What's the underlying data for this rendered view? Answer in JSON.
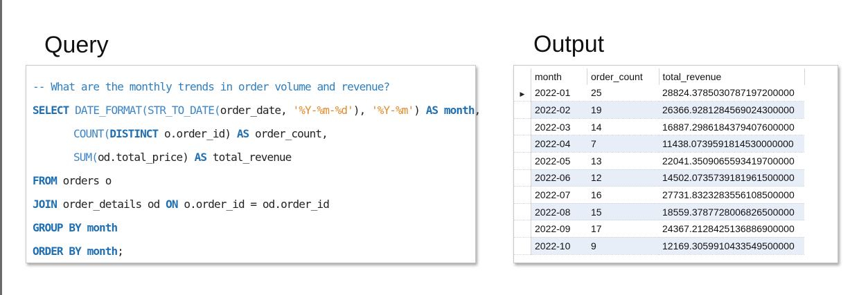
{
  "query_heading": "Query",
  "output_heading": "Output",
  "code": {
    "comment": "-- What are the monthly trends in order volume and revenue?",
    "select_kw": "SELECT",
    "date_format_fn": "DATE_FORMAT(",
    "str_to_date_fn": "STR_TO_DATE(",
    "order_date_arg": "order_date, ",
    "fmt_ymd": "'%Y-%m-%d'",
    "close_comma": "), ",
    "fmt_ym": "'%Y-%m'",
    "close_paren": ") ",
    "as_kw": "AS",
    "month_alias": " month",
    "comma": ",",
    "count_fn": "COUNT(",
    "distinct_kw": "DISTINCT",
    "count_arg": " o.order_id) ",
    "order_count_alias": " order_count,",
    "sum_fn": "SUM(",
    "sum_arg": "od.total_price) ",
    "total_revenue_alias": " total_revenue",
    "from_kw": "FROM",
    "from_rest": " orders o",
    "join_kw": "JOIN",
    "join_rest": " order_details od ",
    "on_kw": "ON",
    "on_rest": " o.order_id = od.order_id",
    "group_by": "GROUP BY month",
    "order_by_kw": "ORDER BY month",
    "semicolon": ";"
  },
  "grid": {
    "columns": [
      "month",
      "order_count",
      "total_revenue"
    ],
    "current_row_marker": "▶",
    "rows": [
      [
        "2022-01",
        "25",
        "28824.3785030787197200000"
      ],
      [
        "2022-02",
        "19",
        "26366.9281284569024300000"
      ],
      [
        "2022-03",
        "14",
        "16887.2986184379407600000"
      ],
      [
        "2022-04",
        "7",
        "11438.0739591814530000000"
      ],
      [
        "2022-05",
        "13",
        "22041.3509065593419700000"
      ],
      [
        "2022-06",
        "12",
        "14502.0735739181961500000"
      ],
      [
        "2022-07",
        "16",
        "27731.8323283556108500000"
      ],
      [
        "2022-08",
        "15",
        "18559.3787728006826500000"
      ],
      [
        "2022-09",
        "17",
        "24367.2128425136886900000"
      ],
      [
        "2022-10",
        "9",
        "12169.3059910433549500000"
      ]
    ]
  }
}
